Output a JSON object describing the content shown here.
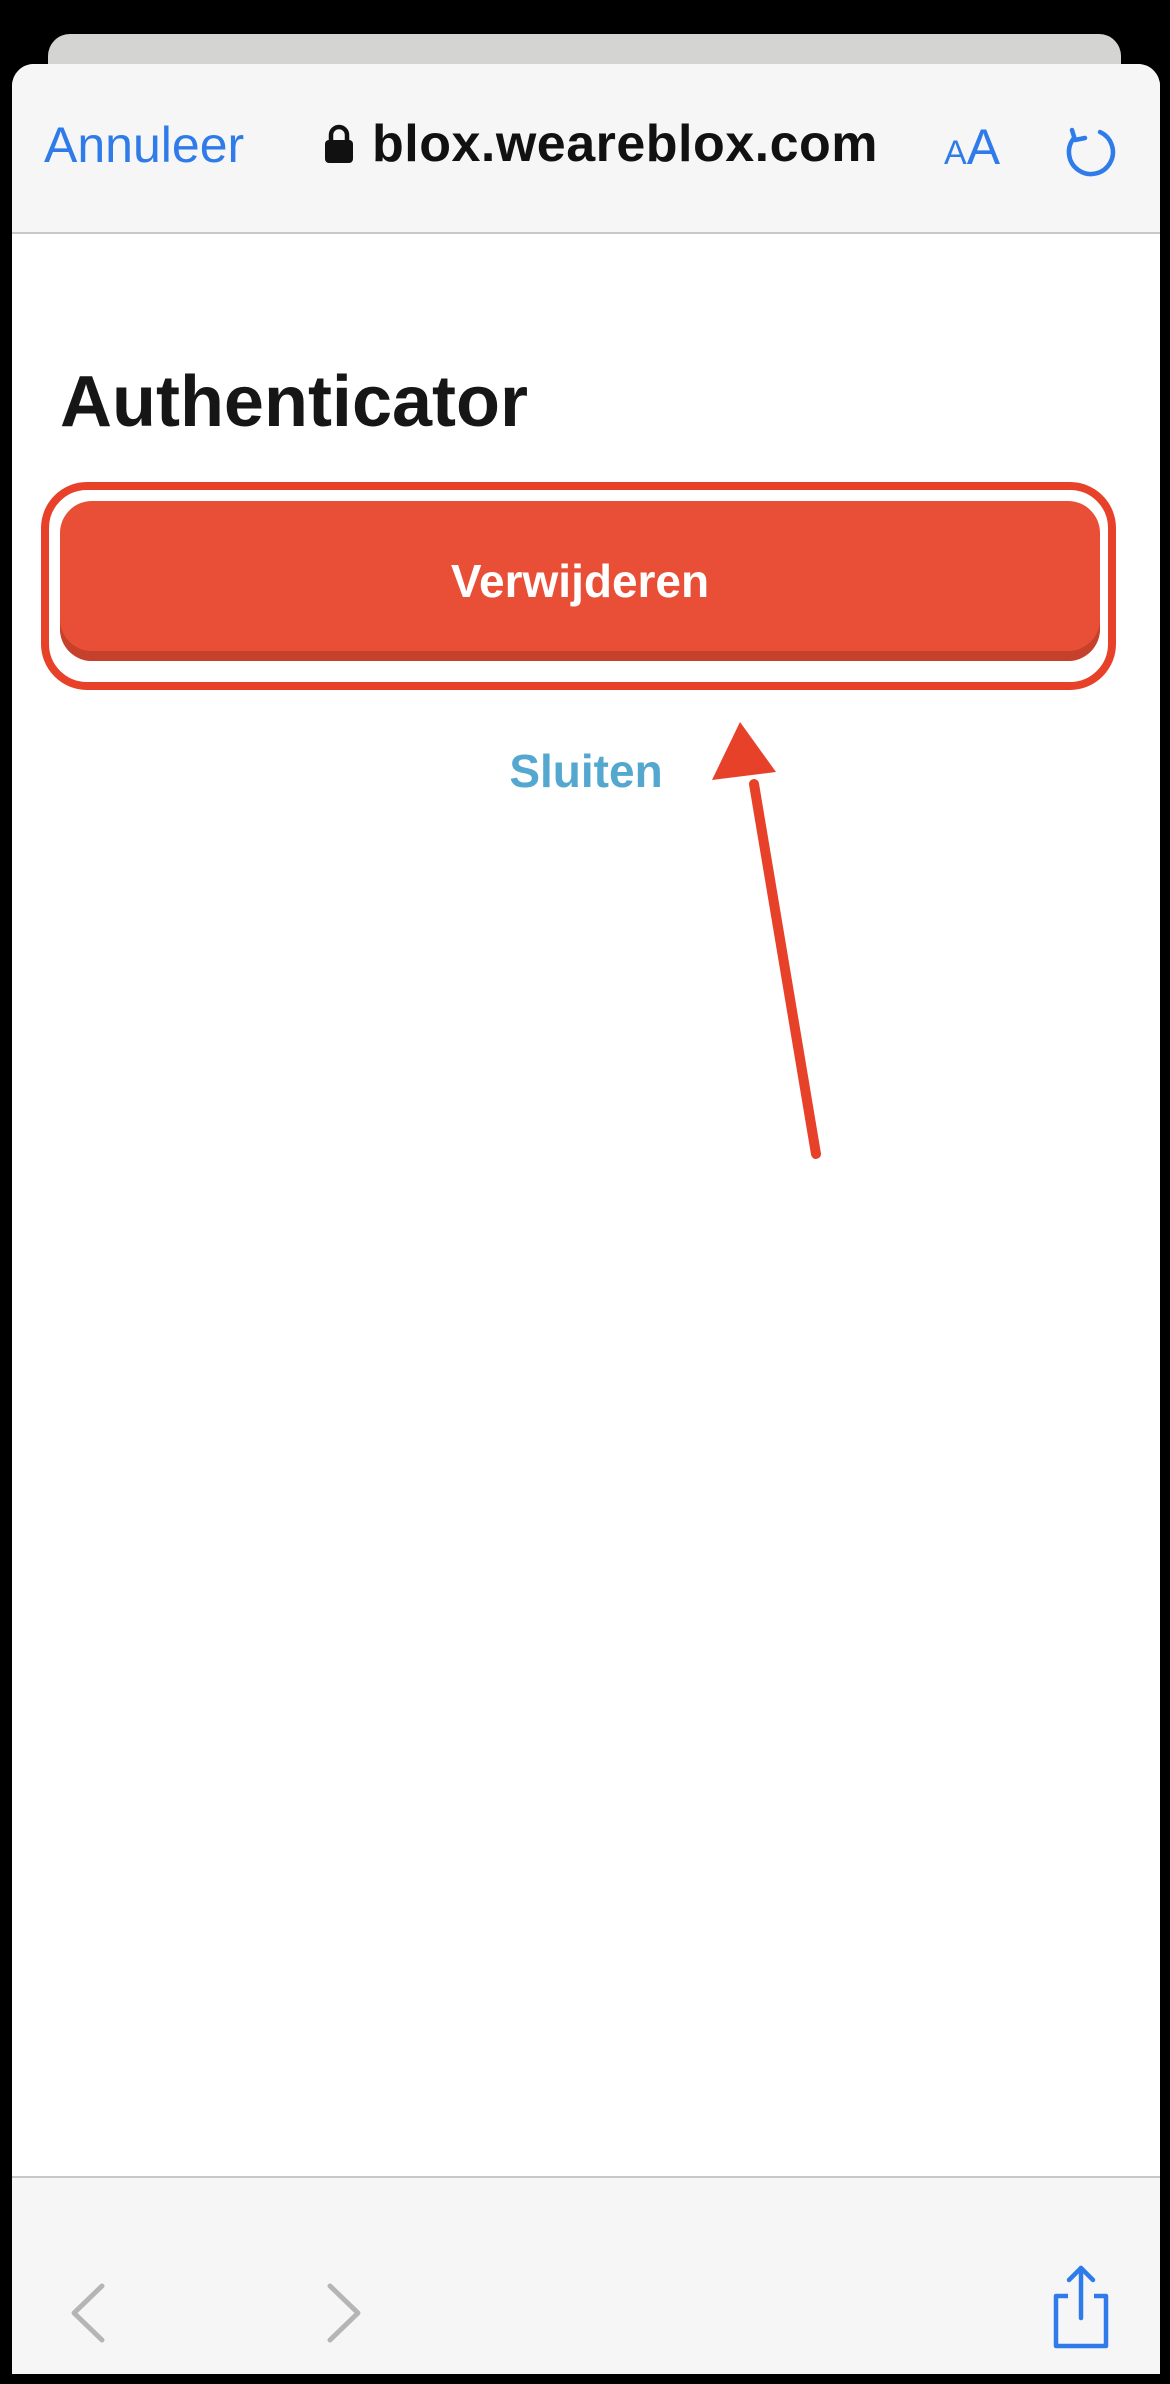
{
  "browser": {
    "cancel_label": "Annuleer",
    "url": "blox.weareblox.com",
    "text_size_small": "A",
    "text_size_large": "A"
  },
  "page": {
    "title": "Authenticator",
    "delete_button_label": "Verwijderen",
    "close_label": "Sluiten"
  },
  "colors": {
    "accent_blue": "#2f7bea",
    "delete_red": "#e94f37",
    "annotation_red": "#e8412a",
    "close_link_blue": "#54a8cf"
  },
  "icons": {
    "lock": "lock-icon",
    "reload": "reload-icon",
    "back": "chevron-left-icon",
    "forward": "chevron-right-icon",
    "share": "share-icon"
  }
}
